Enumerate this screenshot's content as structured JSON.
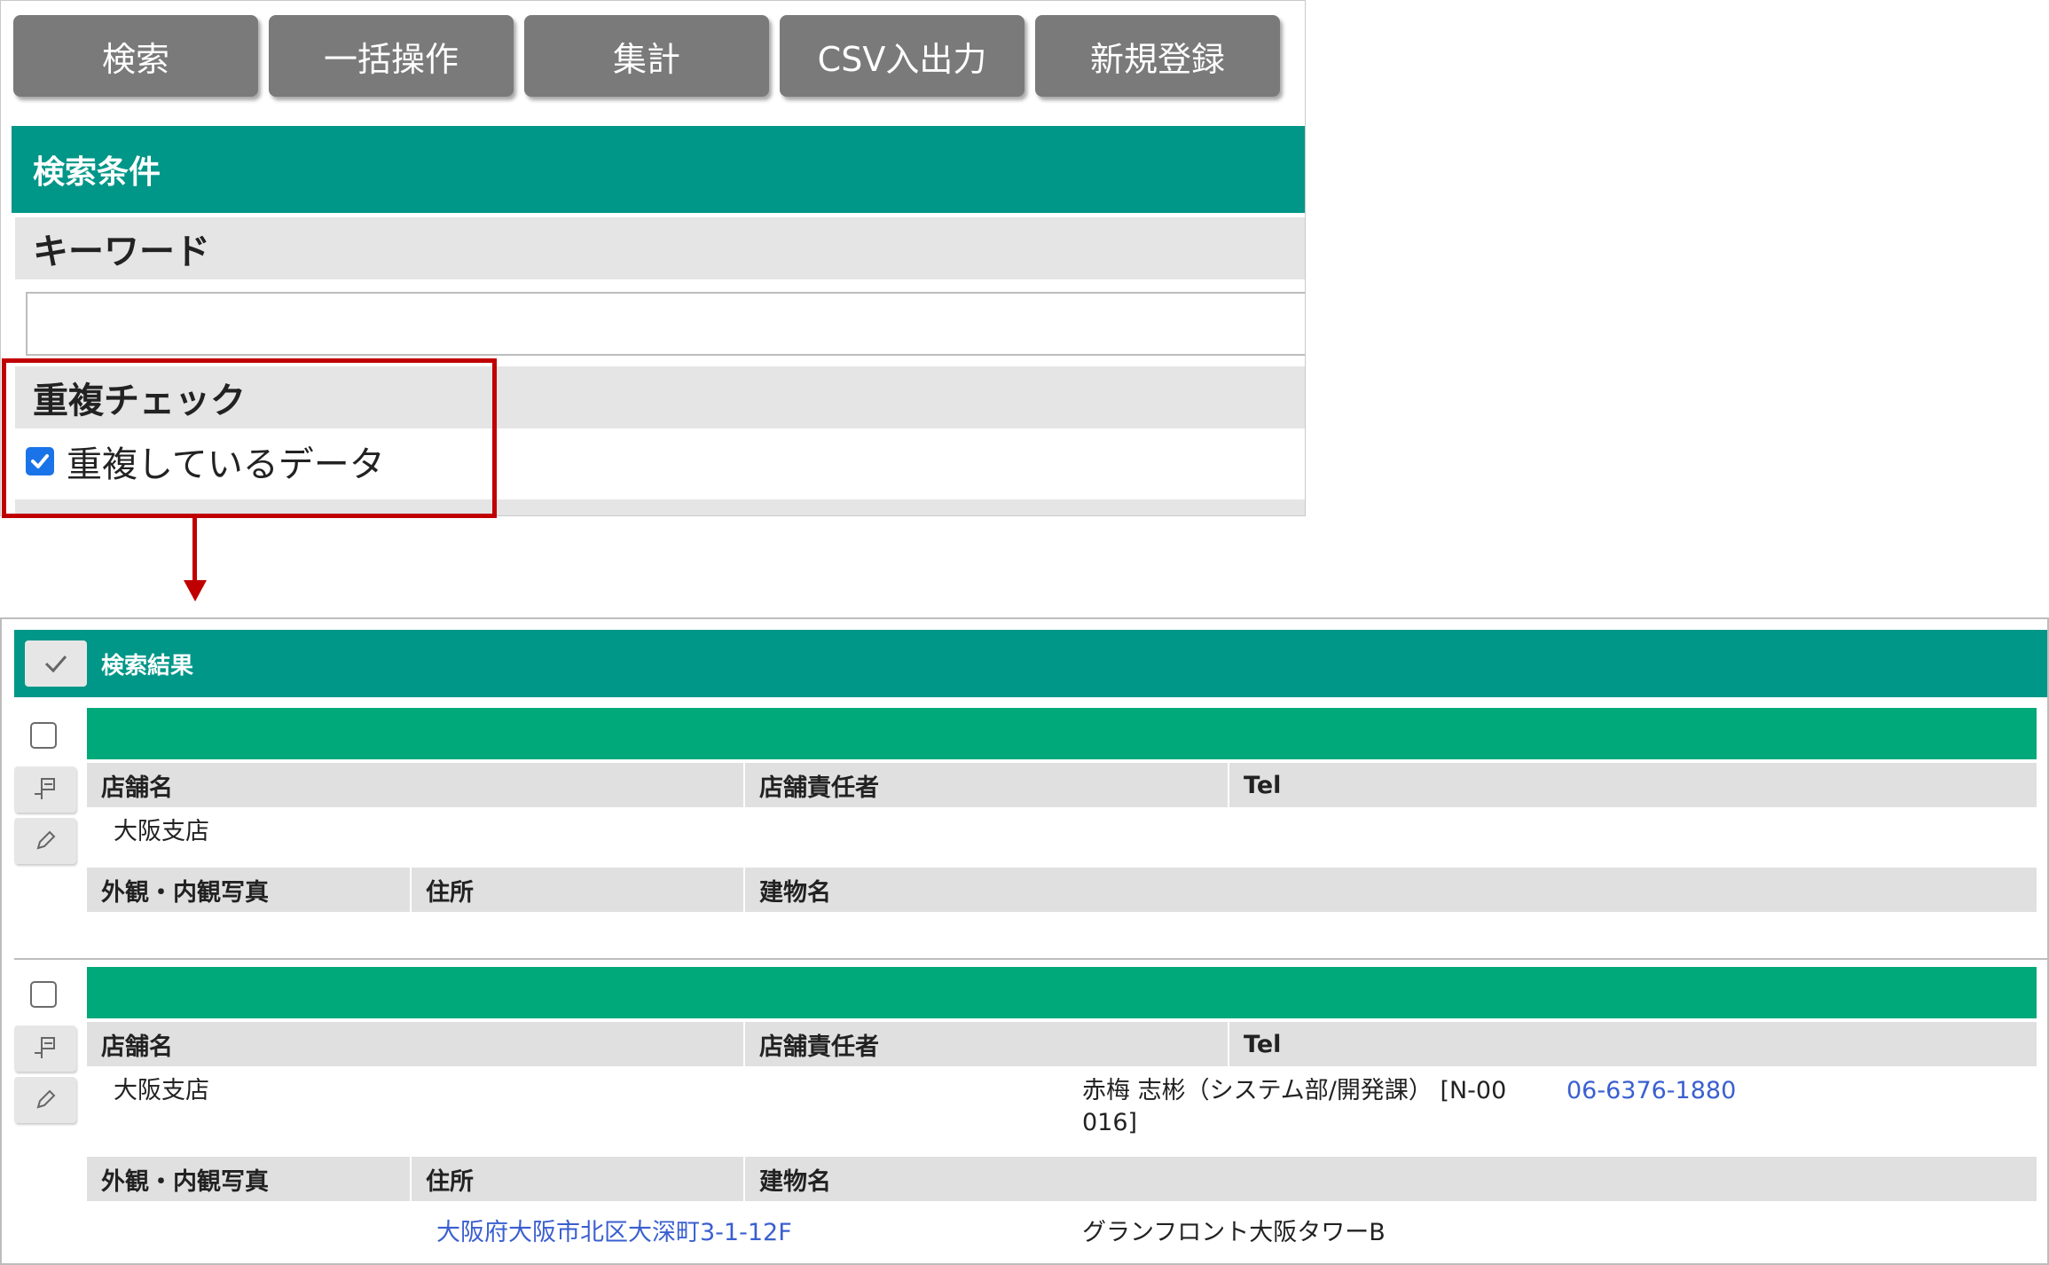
{
  "toolbar": {
    "buttons": [
      "検索",
      "一括操作",
      "集計",
      "CSV入出力",
      "新規登録"
    ]
  },
  "search_conditions": {
    "title": "検索条件",
    "keyword_label": "キーワード",
    "keyword_value": "",
    "duplicate_label": "重複チェック",
    "duplicate_option": "重複しているデータ",
    "duplicate_checked": true
  },
  "results": {
    "title": "検索結果",
    "columns": {
      "store_name": "店舗名",
      "manager": "店舗責任者",
      "tel": "Tel",
      "photo": "外観・内観写真",
      "address": "住所",
      "building": "建物名"
    },
    "records": [
      {
        "store_name": "大阪支店",
        "manager_line1": "",
        "manager_line2": "",
        "tel": "",
        "photo": "",
        "address": "",
        "building": ""
      },
      {
        "store_name": "大阪支店",
        "manager_line1": "赤梅 志彬（システム部/開発課） [N-00",
        "manager_line2": "016]",
        "tel": "06-6376-1880",
        "photo": "",
        "address": "大阪府大阪市北区大深町3-1-12F",
        "building": "グランフロント大阪タワーB"
      }
    ]
  },
  "colors": {
    "teal_header": "#009688",
    "green_bar": "#00a97a",
    "annotation_red": "#c00000",
    "link_blue": "#3a5fd0",
    "toolbar_gray": "#7a7a7a"
  },
  "icons": {
    "select_all": "checkmark-icon",
    "detail": "detail-icon",
    "edit": "pencil-icon"
  }
}
